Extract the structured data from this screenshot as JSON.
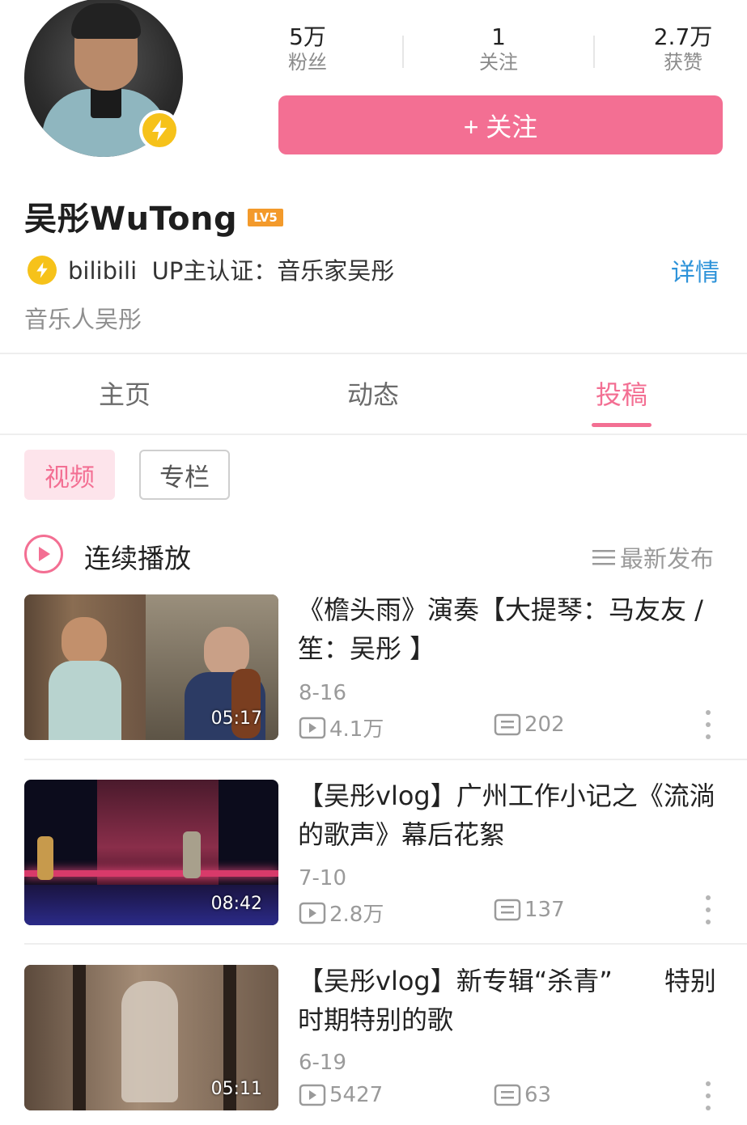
{
  "profile": {
    "fans_count": "5万",
    "fans_label": "粉丝",
    "following_count": "1",
    "following_label": "关注",
    "likes_count": "2.7万",
    "likes_label": "获赞",
    "follow_button": "+ 关注",
    "name": "吴彤WuTong",
    "level": "LV5",
    "verify_text": "bilibili  UP主认证：音乐家吴彤",
    "detail_link": "详情",
    "signature": "音乐人吴彤"
  },
  "tabs": [
    {
      "label": "主页"
    },
    {
      "label": "动态"
    },
    {
      "label": "投稿",
      "active": true
    }
  ],
  "filters": [
    {
      "label": "视频",
      "active": true
    },
    {
      "label": "专栏"
    }
  ],
  "playlist": {
    "continuous_play": "连续播放",
    "sort_label": "最新发布"
  },
  "videos": [
    {
      "title": "《檐头雨》演奏【大提琴：马友友 / 笙：吴彤 】",
      "date": "8-16",
      "views": "4.1万",
      "comments": "202",
      "duration": "05:17"
    },
    {
      "title": "【吴彤vlog】广州工作小记之《流淌的歌声》幕后花絮",
      "date": "7-10",
      "views": "2.8万",
      "comments": "137",
      "duration": "08:42"
    },
    {
      "title": "【吴彤vlog】新专辑“杀青”　　特别时期特别的歌",
      "date": "6-19",
      "views": "5427",
      "comments": "63",
      "duration": "05:11"
    }
  ],
  "colors": {
    "accent": "#f36f93",
    "link": "#2e93d9",
    "verify": "#f6c21a"
  }
}
